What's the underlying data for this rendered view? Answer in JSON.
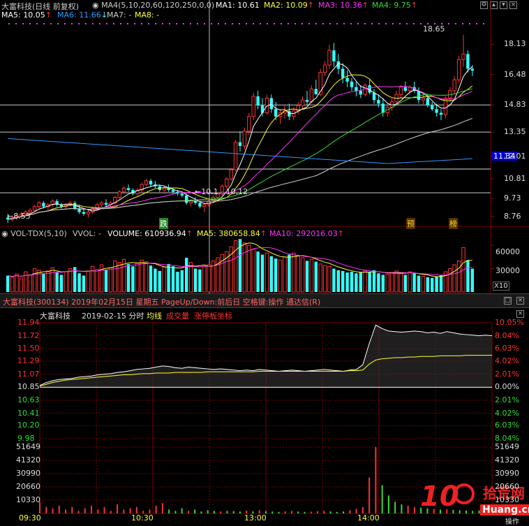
{
  "colors": {
    "ma1": "#ffffff",
    "ma2": "#ffff33",
    "ma3": "#ff33ff",
    "ma4": "#33dd33",
    "ma5": "#ffffff",
    "ma6": "#3399ff",
    "up": "#ff3333",
    "down": "#33ffff",
    "grid": "#7a0000",
    "limit": "#ff66ff"
  },
  "kline": {
    "title": "大富科技(日线 前复权)",
    "params": "MA4(5,10,20,60,120,250,0,0)",
    "ma1": "MA1: 10.61",
    "ma2": "MA2: 10.09",
    "ma3": "MA3: 10.36",
    "ma4": "MA4: 9.75",
    "ma5": "MA5: 10.05",
    "ma6": "MA6: 11.66",
    "ma7": "MA7: -",
    "ma8": "MA8: -",
    "y_labels": [
      "18.13",
      "16.48",
      "14.83",
      "13.35",
      "12.01",
      "10.81",
      "9.73",
      "8.76"
    ],
    "price_tag": "11.34",
    "high_label": "18.65",
    "low_label": "8.55",
    "mid_label": "10.1 - 10.12",
    "event_die": "跌",
    "event_yu": "预",
    "event_bang": "榜"
  },
  "volume": {
    "title": "VOL-TDX(5,10)",
    "vvol": "VVOL: -",
    "volume": "VOLUME: 610936.94",
    "ma5": "MA5: 380658.84",
    "ma10": "MA10: 292016.03",
    "y_labels": [
      "60000",
      "30000"
    ],
    "unit": "X10"
  },
  "intraday": {
    "window_title": "大富科技(300134) 2019年02月15日 星期五 PageUp/Down:前后日 空格键:操作 通达信(R)",
    "name": "大富科技",
    "subtitle": "2019-02-15 分时",
    "avg_label": "均线",
    "vol_label": "成交量",
    "limit_label": "涨停板坐标",
    "price_labels": [
      "11.94",
      "11.72",
      "11.50",
      "11.29",
      "11.07",
      "10.85",
      "10.63",
      "10.41",
      "10.20",
      "9.98"
    ],
    "pct_labels": [
      "10.05%",
      "8.04%",
      "6.03%",
      "4.02%",
      "2.01%",
      "0.00%",
      "2.01%",
      "4.02%",
      "6.03%",
      "8.04%"
    ],
    "vol_labels": [
      "51649",
      "41320",
      "30990",
      "20660",
      "10330"
    ],
    "vol_labels_right": [
      "51649",
      "41320",
      "30990",
      "20660",
      "10330"
    ],
    "time_labels": [
      "09:30",
      "10:30",
      "13:00",
      "14:00"
    ],
    "corner": "操作"
  },
  "watermark": {
    "big": "10",
    "brand": "拾荒网",
    "url": "Huang.cn"
  },
  "chart_data": [
    {
      "type": "candlestick",
      "title": "大富科技(日线 前复权)",
      "ylim": [
        8.3,
        19.4
      ],
      "y_ticks": [
        18.13,
        16.48,
        14.83,
        13.35,
        12.01,
        10.81,
        9.73,
        8.76
      ],
      "horizontal_lines": [
        14.83,
        13.35,
        11.34,
        10.05
      ],
      "annotations": {
        "high": 18.65,
        "low": 8.55
      },
      "ohlc": [
        [
          8.7,
          8.9,
          8.4,
          8.6
        ],
        [
          8.6,
          8.8,
          8.5,
          8.7
        ],
        [
          8.7,
          8.9,
          8.55,
          8.8
        ],
        [
          8.8,
          9.0,
          8.7,
          8.9
        ],
        [
          8.9,
          9.1,
          8.8,
          9.0
        ],
        [
          9.0,
          9.2,
          8.9,
          9.1
        ],
        [
          9.1,
          9.4,
          9.0,
          9.3
        ],
        [
          9.3,
          9.6,
          9.2,
          9.5
        ],
        [
          9.5,
          9.6,
          9.2,
          9.3
        ],
        [
          9.3,
          9.5,
          9.1,
          9.4
        ],
        [
          9.4,
          9.7,
          9.3,
          9.6
        ],
        [
          9.6,
          9.7,
          9.3,
          9.4
        ],
        [
          9.4,
          9.5,
          9.2,
          9.3
        ],
        [
          9.3,
          9.5,
          9.2,
          9.4
        ],
        [
          9.4,
          9.6,
          9.3,
          9.5
        ],
        [
          9.5,
          9.6,
          9.1,
          9.2
        ],
        [
          9.2,
          9.4,
          8.9,
          9.0
        ],
        [
          9.0,
          9.2,
          8.8,
          8.9
        ],
        [
          8.9,
          9.1,
          8.7,
          9.0
        ],
        [
          9.0,
          9.3,
          8.9,
          9.2
        ],
        [
          9.2,
          9.5,
          9.1,
          9.4
        ],
        [
          9.4,
          9.6,
          9.3,
          9.5
        ],
        [
          9.5,
          9.7,
          9.3,
          9.4
        ],
        [
          9.4,
          9.6,
          9.3,
          9.5
        ],
        [
          9.5,
          9.9,
          9.4,
          9.8
        ],
        [
          9.8,
          10.2,
          9.7,
          10.1
        ],
        [
          10.1,
          10.4,
          10.0,
          10.3
        ],
        [
          10.3,
          10.5,
          10.1,
          10.2
        ],
        [
          10.2,
          10.3,
          9.9,
          10.0
        ],
        [
          10.0,
          10.3,
          9.9,
          10.2
        ],
        [
          10.2,
          10.6,
          10.1,
          10.5
        ],
        [
          10.5,
          10.8,
          10.4,
          10.7
        ],
        [
          10.7,
          10.8,
          10.4,
          10.5
        ],
        [
          10.5,
          10.7,
          10.3,
          10.4
        ],
        [
          10.4,
          10.5,
          10.1,
          10.2
        ],
        [
          10.2,
          10.4,
          10.0,
          10.3
        ],
        [
          10.3,
          10.5,
          10.1,
          10.2
        ],
        [
          10.2,
          10.3,
          10.0,
          10.1
        ],
        [
          10.1,
          10.2,
          9.9,
          10.0
        ],
        [
          10.0,
          10.1,
          9.8,
          9.9
        ],
        [
          9.9,
          10.0,
          9.4,
          9.5
        ],
        [
          9.5,
          9.7,
          9.3,
          9.6
        ],
        [
          9.6,
          9.8,
          9.4,
          9.5
        ],
        [
          9.5,
          9.6,
          9.2,
          9.3
        ],
        [
          9.3,
          9.5,
          9.0,
          9.4
        ],
        [
          9.4,
          9.7,
          9.3,
          9.6
        ],
        [
          9.6,
          9.9,
          9.5,
          9.8
        ],
        [
          9.8,
          10.1,
          9.7,
          10.0
        ],
        [
          10.0,
          10.5,
          9.9,
          10.4
        ],
        [
          10.4,
          10.9,
          10.3,
          10.8
        ],
        [
          10.8,
          11.4,
          10.7,
          11.3
        ],
        [
          11.3,
          12.9,
          11.2,
          12.8
        ],
        [
          12.8,
          13.4,
          12.3,
          12.6
        ],
        [
          12.6,
          13.6,
          12.4,
          13.4
        ],
        [
          13.4,
          14.4,
          13.2,
          14.2
        ],
        [
          14.2,
          15.5,
          14.0,
          15.3
        ],
        [
          15.3,
          15.6,
          14.6,
          14.8
        ],
        [
          14.8,
          15.2,
          14.2,
          14.4
        ],
        [
          14.4,
          15.4,
          14.3,
          15.2
        ],
        [
          15.2,
          15.4,
          14.4,
          14.6
        ],
        [
          14.6,
          15.0,
          14.0,
          14.2
        ],
        [
          14.2,
          14.6,
          13.8,
          14.4
        ],
        [
          14.4,
          14.8,
          14.1,
          14.5
        ],
        [
          14.5,
          14.9,
          14.0,
          14.2
        ],
        [
          14.2,
          14.7,
          14.0,
          14.5
        ],
        [
          14.5,
          15.0,
          14.3,
          14.8
        ],
        [
          14.8,
          15.3,
          14.6,
          15.1
        ],
        [
          15.1,
          15.6,
          14.8,
          15.0
        ],
        [
          15.0,
          15.9,
          14.9,
          15.7
        ],
        [
          15.7,
          16.2,
          15.5,
          15.4
        ],
        [
          15.4,
          16.8,
          15.3,
          16.6
        ],
        [
          16.6,
          17.2,
          16.4,
          17.0
        ],
        [
          17.0,
          18.1,
          16.8,
          17.8
        ],
        [
          17.8,
          18.2,
          16.9,
          17.2
        ],
        [
          17.2,
          17.6,
          16.5,
          16.8
        ],
        [
          16.8,
          17.1,
          16.0,
          16.3
        ],
        [
          16.3,
          16.7,
          15.8,
          16.1
        ],
        [
          16.1,
          16.3,
          15.6,
          15.8
        ],
        [
          15.8,
          16.1,
          15.3,
          15.6
        ],
        [
          15.6,
          15.9,
          15.2,
          15.4
        ],
        [
          15.4,
          16.0,
          15.3,
          15.9
        ],
        [
          15.9,
          16.2,
          15.4,
          15.5
        ],
        [
          15.5,
          15.7,
          14.9,
          15.1
        ],
        [
          15.1,
          15.4,
          14.7,
          14.9
        ],
        [
          14.9,
          15.2,
          14.2,
          14.4
        ],
        [
          14.4,
          14.9,
          14.2,
          14.7
        ],
        [
          14.7,
          15.2,
          14.5,
          15.0
        ],
        [
          15.0,
          15.6,
          14.8,
          15.4
        ],
        [
          15.4,
          15.9,
          15.2,
          15.8
        ],
        [
          15.8,
          16.1,
          15.5,
          15.6
        ],
        [
          15.6,
          15.9,
          15.4,
          15.8
        ],
        [
          15.8,
          16.1,
          15.5,
          15.6
        ],
        [
          15.6,
          15.8,
          14.9,
          15.1
        ],
        [
          15.1,
          15.4,
          14.8,
          15.2
        ],
        [
          15.2,
          15.4,
          14.7,
          14.8
        ],
        [
          14.8,
          15.0,
          14.5,
          14.6
        ],
        [
          14.6,
          14.9,
          14.2,
          14.4
        ],
        [
          14.4,
          14.6,
          14.0,
          14.3
        ],
        [
          14.3,
          15.3,
          14.1,
          15.2
        ],
        [
          15.2,
          15.8,
          15.0,
          15.6
        ],
        [
          15.6,
          16.4,
          15.4,
          16.2
        ],
        [
          16.2,
          17.5,
          16.0,
          17.3
        ],
        [
          17.3,
          18.65,
          16.9,
          17.6
        ],
        [
          17.6,
          17.8,
          16.6,
          16.8
        ],
        [
          16.8,
          17.0,
          16.4,
          16.7
        ]
      ]
    },
    {
      "type": "bar",
      "title": "VOL-TDX(5,10)",
      "values": [
        21000,
        19000,
        23000,
        18000,
        26000,
        22000,
        30000,
        28000,
        24000,
        27000,
        31000,
        25000,
        22000,
        26000,
        30000,
        32000,
        24000,
        21000,
        27000,
        33000,
        29000,
        35000,
        28000,
        31000,
        40000,
        38000,
        42000,
        36000,
        33000,
        37000,
        41000,
        39000,
        34000,
        30000,
        27000,
        32000,
        36000,
        33000,
        26000,
        28000,
        44000,
        38000,
        30000,
        29000,
        33000,
        35000,
        40000,
        44000,
        48000,
        52000,
        58000,
        66000,
        68000,
        63000,
        60000,
        55000,
        52000,
        48000,
        50000,
        46000,
        43000,
        41000,
        45000,
        48000,
        50000,
        47000,
        44000,
        40000,
        42000,
        39000,
        36000,
        34000,
        33000,
        30000,
        28000,
        27000,
        25000,
        26000,
        24000,
        25000,
        27000,
        26000,
        28000,
        24000,
        22000,
        23000,
        25000,
        27000,
        24000,
        22000,
        26000,
        24000,
        21000,
        20000,
        19000,
        18000,
        20000,
        22000,
        26000,
        30000,
        35000,
        40000,
        57000,
        41000,
        30000
      ],
      "y_ticks": [
        60000,
        30000
      ],
      "unit": "X10"
    },
    {
      "type": "line",
      "title": "2019-02-15 分时",
      "ylim": [
        9.98,
        11.94
      ],
      "base_price": 10.85,
      "price": [
        10.88,
        10.93,
        10.96,
        10.98,
        10.99,
        11.0,
        11.02,
        11.03,
        11.04,
        11.06,
        11.07,
        11.08,
        11.1,
        11.11,
        11.13,
        11.15,
        11.16,
        11.17,
        11.19,
        11.21,
        11.2,
        11.18,
        11.17,
        11.19,
        11.18,
        11.17,
        11.16,
        11.15,
        11.16,
        11.15,
        11.14,
        11.13,
        11.14,
        11.13,
        11.15,
        11.14,
        11.13,
        11.12,
        11.13,
        11.14,
        11.13,
        11.12,
        11.13,
        11.14,
        11.15,
        11.14,
        11.13,
        11.12,
        11.14,
        11.15,
        11.23,
        11.59,
        11.9,
        11.84,
        11.8,
        11.79,
        11.78,
        11.79,
        11.8,
        11.79,
        11.77,
        11.78,
        11.76,
        11.79,
        11.77,
        11.75,
        11.74,
        11.73,
        11.72,
        11.73,
        11.72
      ],
      "avg_price": [
        10.87,
        10.9,
        10.93,
        10.95,
        10.97,
        10.98,
        10.99,
        11.0,
        11.01,
        11.02,
        11.03,
        11.04,
        11.05,
        11.06,
        11.06,
        11.07,
        11.08,
        11.08,
        11.09,
        11.09,
        11.09,
        11.1,
        11.1,
        11.1,
        11.1,
        11.1,
        11.11,
        11.11,
        11.11,
        11.11,
        11.11,
        11.11,
        11.11,
        11.11,
        11.12,
        11.12,
        11.12,
        11.12,
        11.12,
        11.12,
        11.12,
        11.12,
        11.12,
        11.12,
        11.12,
        11.12,
        11.12,
        11.12,
        11.13,
        11.13,
        11.14,
        11.24,
        11.31,
        11.33,
        11.34,
        11.35,
        11.35,
        11.36,
        11.36,
        11.37,
        11.37,
        11.37,
        11.38,
        11.38,
        11.38,
        11.38,
        11.39,
        11.39,
        11.39,
        11.39,
        11.39
      ],
      "volume": [
        9000,
        5000,
        4000,
        6000,
        3000,
        5000,
        2000,
        4000,
        6000,
        3000,
        5000,
        2000,
        7000,
        3000,
        4000,
        5000,
        2000,
        3000,
        6000,
        8000,
        3000,
        2000,
        4000,
        2000,
        3000,
        1500,
        2500,
        2000,
        1500,
        2000,
        1800,
        1500,
        2200,
        1600,
        2500,
        1800,
        1500,
        1200,
        1600,
        2000,
        1500,
        1200,
        1400,
        1800,
        2000,
        1600,
        1200,
        1500,
        2500,
        3500,
        5000,
        28000,
        51649,
        22000,
        14000,
        9000,
        7000,
        6000,
        5000,
        4500,
        4000,
        3500,
        3000,
        3200,
        2800,
        2500,
        2200,
        2000,
        2400,
        2100,
        2600
      ],
      "time_ticks": [
        "09:30",
        "10:30",
        "13:00",
        "14:00"
      ]
    }
  ]
}
